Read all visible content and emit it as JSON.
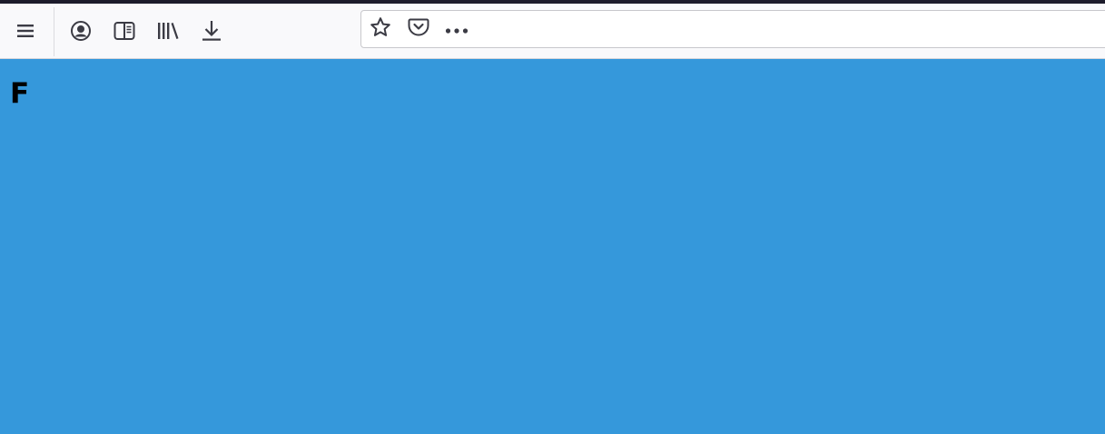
{
  "toolbar": {
    "buttons": [
      {
        "icon": "hamburger-menu-icon"
      },
      {
        "icon": "account-icon"
      },
      {
        "icon": "sidebar-icon"
      },
      {
        "icon": "library-icon"
      },
      {
        "icon": "download-icon"
      }
    ]
  },
  "urlbar": {
    "value": "",
    "actions": [
      {
        "icon": "bookmark-star-icon"
      },
      {
        "icon": "pocket-icon"
      },
      {
        "icon": "more-actions-icon"
      }
    ]
  },
  "page": {
    "heading": "F",
    "background_color": "#3598db",
    "text_color": "#000000"
  },
  "colors": {
    "toolbar_bg": "#f9f9fb",
    "icon": "#3b3b44",
    "top_strip": "#1c1b2b"
  }
}
